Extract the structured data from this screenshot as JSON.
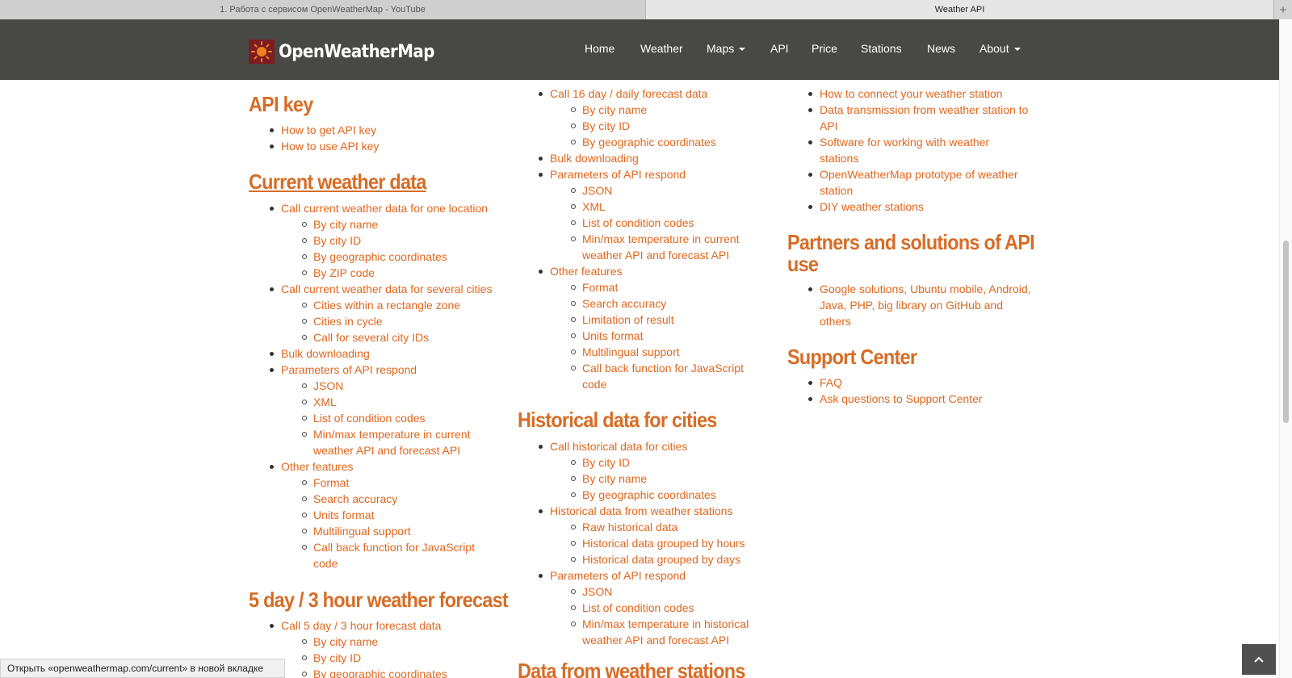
{
  "browser": {
    "tabs": [
      "1. Работа с сервисом OpenWeatherMap - YouTube",
      "Weather API"
    ],
    "new_tab_symbol": "+"
  },
  "site": {
    "logo_text": "OpenWeatherMap",
    "nav": [
      "Home",
      "Weather",
      "Maps",
      "API",
      "Price",
      "Stations",
      "News",
      "About"
    ]
  },
  "col1": {
    "api_key": {
      "title": "API key",
      "items": [
        "How to get API key",
        "How to use API key"
      ]
    },
    "current": {
      "title": "Current weather data",
      "items": [
        "Call current weather data for one location",
        "By city name",
        "By city ID",
        "By geographic coordinates",
        "By ZIP code",
        "Call current weather data for several cities",
        "Cities within a rectangle zone",
        "Cities in cycle",
        "Call for several city IDs",
        "Bulk downloading",
        "Parameters of API respond",
        "JSON",
        "XML",
        "List of condition codes",
        "Min/max temperature in current",
        "weather API and forecast API",
        "Other features",
        "Format",
        "Search accuracy",
        "Units format",
        "Multilingual support",
        "Call back function for JavaScript",
        "code"
      ]
    },
    "forecast5": {
      "title": "5 day / 3 hour weather forecast",
      "items": [
        "Call 5 day / 3 hour forecast data",
        "By city name",
        "By city ID",
        "By geographic coordinates"
      ]
    }
  },
  "col2": {
    "daily": {
      "items": [
        "Call 16 day / daily forecast data",
        "By city name",
        "By city ID",
        "By geographic coordinates",
        "Bulk downloading",
        "Parameters of API respond",
        "JSON",
        "XML",
        "List of condition codes",
        "Min/max temperature in current",
        "weather API and forecast API",
        "Other features",
        "Format",
        "Search accuracy",
        "Limitation of result",
        "Units format",
        "Multilingual support",
        "Call back function for JavaScript",
        "code"
      ]
    },
    "historical": {
      "title": "Historical data for cities",
      "items": [
        "Call historical data for cities",
        "By city ID",
        "By city name",
        "By geographic coordinates",
        "Historical data from weather stations",
        "Raw historical data",
        "Historical data grouped by hours",
        "Historical data grouped by days",
        "Parameters of API respond",
        "JSON",
        "List of condition codes",
        "Min/max temperature in historical",
        "weather API and forecast API"
      ]
    },
    "stations_title": "Data from weather stations"
  },
  "col3": {
    "stations": {
      "items": [
        "How to connect your weather station",
        "Data transmission from weather station to",
        "API",
        "Software for working with weather",
        "stations",
        "OpenWeatherMap prototype of weather",
        "station",
        "DIY weather stations"
      ]
    },
    "partners": {
      "title_lines": [
        "Partners and solutions of API",
        "use"
      ],
      "items": [
        "Google solutions, Ubuntu mobile, Android,",
        "Java, PHP, big library on GitHub and",
        "others"
      ]
    },
    "support": {
      "title": "Support Center",
      "items": [
        "FAQ",
        "Ask questions to Support Center"
      ]
    }
  },
  "status": {
    "text": "Открыть «openweathermap.com/current» в новой вкладке"
  },
  "colors": {
    "accent": "#e0671e",
    "heading": "#d66d26",
    "navbar": "#484845",
    "logo_bg": "#7d1d22"
  }
}
